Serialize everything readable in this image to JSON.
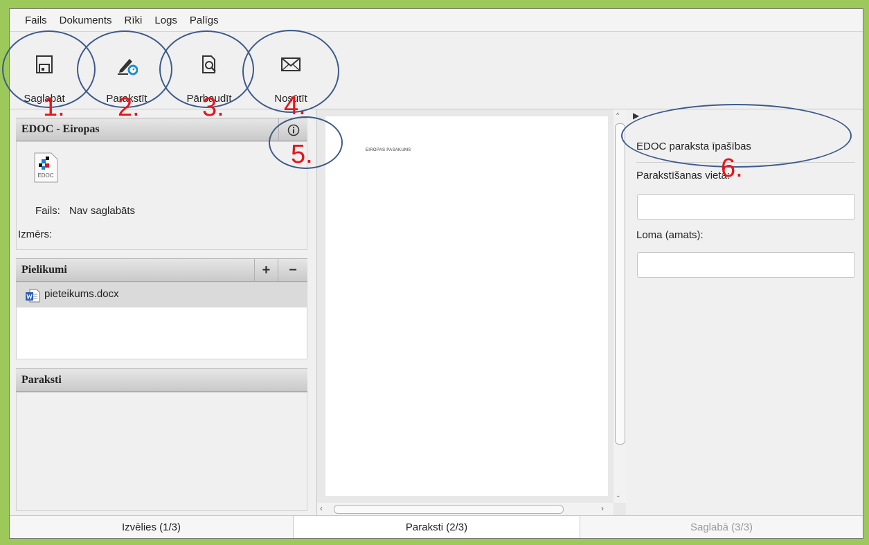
{
  "menu": [
    "Fails",
    "Dokuments",
    "Rīki",
    "Logs",
    "Palīgs"
  ],
  "toolbar": {
    "save": {
      "label": "Saglabāt",
      "icon": "floppy-disk-icon"
    },
    "sign": {
      "label": "Parakstīt",
      "icon": "pen-icon"
    },
    "verify": {
      "label": "Pārbaudīt",
      "icon": "document-search-icon"
    },
    "send": {
      "label": "Nosūtīt",
      "icon": "envelope-icon"
    }
  },
  "annotations": {
    "n1": "1.",
    "n2": "2.",
    "n3": "3.",
    "n4": "4.",
    "n5": "5.",
    "n6": "6."
  },
  "edoc_panel": {
    "title": "EDOC - Eiropas",
    "icon_caption": "EDOC",
    "file_label": "Fails:",
    "file_value": "Nav saglabāts",
    "size_label": "Izmērs:",
    "size_value": ""
  },
  "attachments": {
    "title": "Pielikumi",
    "add": "+",
    "remove": "−",
    "items": [
      "pieteikums.docx"
    ]
  },
  "signatures": {
    "title": "Paraksti"
  },
  "preview": {
    "text": "EIROPAS PASAKUMS"
  },
  "properties": {
    "title": "EDOC paraksta īpašības",
    "place_label": "Parakstīšanas vieta:",
    "place_value": "",
    "role_label": "Loma (amats):",
    "role_value": ""
  },
  "steps": [
    "Izvēlies (1/3)",
    "Paraksti (2/3)",
    "Saglabā (3/3)"
  ],
  "colors": {
    "annotation_number": "#e8141a",
    "annotation_ellipse": "#3c5a8a",
    "outer_border": "#9cc95a"
  }
}
